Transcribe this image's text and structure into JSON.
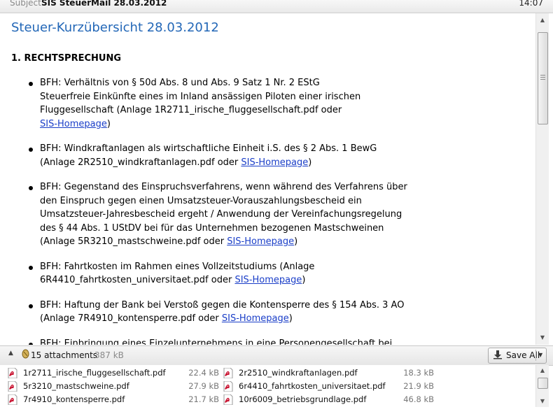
{
  "header": {
    "subject_label": "Subject",
    "subject_value": "SIS SteuerMail 28.03.2012",
    "time": "14:07"
  },
  "message": {
    "title": "Steuer-Kurzübersicht 28.03.2012",
    "section": "1. RECHTSPRECHUNG",
    "link_text": "SIS-Homepage",
    "items": [
      {
        "line1": "BFH: Verhältnis von § 50d Abs. 8 und Abs. 9 Satz 1 Nr. 2 EStG",
        "line2": "Steuerfreie Einkünfte eines im Inland ansässigen Piloten einer irischen",
        "line3": "Fluggesellschaft (Anlage 1R2711_irische_fluggesellschaft.pdf oder",
        "tail": ")"
      },
      {
        "line1": "BFH: Windkraftanlagen als wirtschaftliche Einheit i.S. des § 2 Abs. 1 BewG",
        "line2": "(Anlage 2R2510_windkraftanlagen.pdf oder ",
        "tail": ")"
      },
      {
        "line1": "BFH: Gegenstand des Einspruchsverfahrens, wenn während des Verfahrens über",
        "line2": "den Einspruch gegen einen Umsatzsteuer-Vorauszahlungsbescheid ein",
        "line3": "Umsatzsteuer-Jahresbescheid ergeht / Anwendung der Vereinfachungsregelung",
        "line4": "des § 44 Abs. 1 UStDV bei für das Unternehmen bezogenen Mastschweinen",
        "line5": "(Anlage 5R3210_mastschweine.pdf oder ",
        "tail": ")"
      },
      {
        "line1": "BFH: Fahrtkosten im Rahmen eines Vollzeitstudiums (Anlage",
        "line2": "6R4410_fahrtkosten_universitaet.pdf oder ",
        "tail": ")"
      },
      {
        "line1": "BFH: Haftung der Bank bei Verstoß gegen die Kontensperre des § 154 Abs. 3 AO",
        "line2": "(Anlage 7R4910_kontensperre.pdf oder ",
        "tail": ")"
      },
      {
        "line1": "BFH: Einbringung eines Einzelunternehmens in eine Personengesellschaft bei"
      }
    ]
  },
  "attachments_bar": {
    "count": "15 attachments",
    "size": "387 kB",
    "save_all": "Save All"
  },
  "attachments": [
    {
      "name": "1r2711_irische_fluggesellschaft.pdf",
      "size": "22.4 kB"
    },
    {
      "name": "2r2510_windkraftanlagen.pdf",
      "size": "18.3 kB"
    },
    {
      "name": "5r3210_mastschweine.pdf",
      "size": "27.9 kB"
    },
    {
      "name": "6r4410_fahrtkosten_universitaet.pdf",
      "size": "21.9 kB"
    },
    {
      "name": "7r4910_kontensperre.pdf",
      "size": "21.7 kB"
    },
    {
      "name": "10r6009_betriebsgrundlage.pdf",
      "size": "46.8 kB"
    }
  ],
  "colors": {
    "title": "#2367b7",
    "link": "#1a3ec8",
    "pdf_icon": "#c8102e"
  }
}
